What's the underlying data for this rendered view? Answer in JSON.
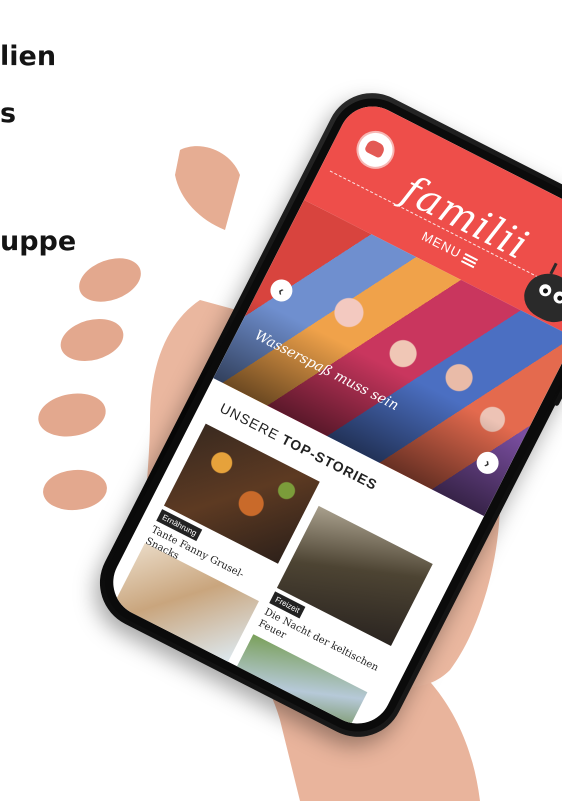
{
  "side_text": [
    "lien",
    "s",
    "uppe"
  ],
  "app": {
    "logo": "familii",
    "menu_label": "MENU",
    "hero": {
      "title": "Wasserspaß muss sein",
      "prev_icon": "chevron-left-icon",
      "next_icon": "chevron-right-icon"
    },
    "section": {
      "prefix": "UNSERE ",
      "bold": "TOP-STORIES"
    },
    "stories": [
      {
        "tag": "Ernährung",
        "title": "Tante Fanny Grusel-Snacks"
      },
      {
        "tag": "Freizeit",
        "title": "Die Nacht der keltischen Feuer"
      }
    ]
  },
  "colors": {
    "brand_red": "#ee4e4a",
    "text_dark": "#141414"
  }
}
